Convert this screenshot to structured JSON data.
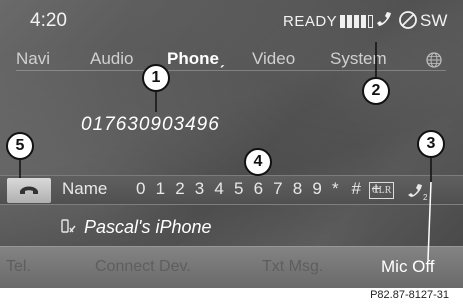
{
  "status_bar": {
    "time": "4:20",
    "ready": "READY",
    "signal_bars_filled": 4,
    "signal_bars_total": 5,
    "direction": "SW",
    "icons": [
      "phone-status-icon",
      "no-navigation-icon"
    ]
  },
  "menu": {
    "items": [
      "Navi",
      "Audio",
      "Phone",
      "Video",
      "System"
    ],
    "active": "Phone",
    "active_marker": "ˏ",
    "end_icon": "globe-icon"
  },
  "dialed_number": "017630903496",
  "dial_row": {
    "end_call_icon": "end-call-icon",
    "name_label": "Name",
    "keys": [
      "0",
      "1",
      "2",
      "3",
      "4",
      "5",
      "6",
      "7",
      "8",
      "9",
      "*",
      "#",
      "+"
    ],
    "clear_label": "CLR",
    "last_icon": "call-waiting-icon"
  },
  "device": {
    "icon": "bluetooth-phone-icon",
    "name": "Pascal's iPhone"
  },
  "bottom_menu": {
    "items": [
      "Tel.",
      "Connect Dev.",
      "Txt Msg.",
      "Mic Off"
    ],
    "active": "Mic Off"
  },
  "callouts": [
    "1",
    "2",
    "3",
    "4",
    "5"
  ],
  "figure_code": "P82.87-8127-31",
  "colors": {
    "screen_bg": "#555555",
    "text": "#f2f2f2",
    "inactive_text": "#5e5e5e",
    "callout_bg": "#ffffff"
  }
}
